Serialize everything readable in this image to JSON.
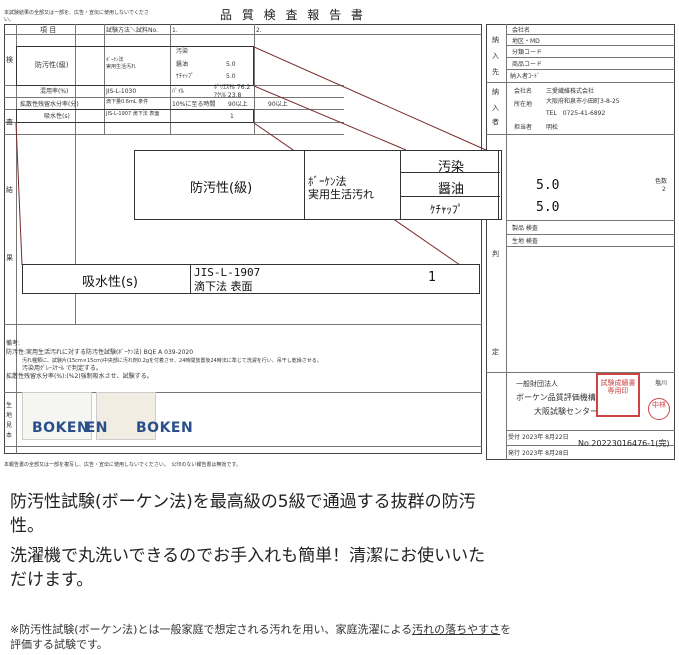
{
  "report": {
    "title": "品 質 検 査 報 告 書",
    "top_notice": "本試験結果の全部又は一部を、広告・宣伝に使用しないでください。",
    "col_item": "項 目",
    "col_method": "試験方法＼試料No.",
    "col1": "1.",
    "col2": "2.",
    "side_left": [
      "検",
      "査",
      "結",
      "果"
    ],
    "rows": [
      {
        "item": "防汚性(級)",
        "method": "ﾎﾞｰｹﾝ法\n実用生活汚れ",
        "stains": [
          "汚染",
          "醤油",
          "ｹﾁｬｯﾌﾟ"
        ],
        "values": [
          "",
          "5.0",
          "5.0"
        ]
      },
      {
        "item": "混用率(%)",
        "method": "JIS-L-1030",
        "comp1": "ﾊﾟｲﾙ",
        "comp2": "ﾎﾟﾘｴｽﾃﾙ 76.2",
        "comp3": "ｱｸﾘﾙ 23.8"
      },
      {
        "item": "拡散性残留水分率(分)",
        "method": "滴下量0.6mL 条件",
        "v1": "10%に至る時間",
        "v2": "90以上",
        "v3": "90以上"
      },
      {
        "item": "吸水性(s)",
        "method": "JIS-L-1907 滴下法 表面",
        "value": "1"
      }
    ],
    "remarks_label": "備考:",
    "remarks": [
      "防汚性:実用生活汚れに対する防汚性試験(ﾎﾞｰｹﾝ法) BQE A 039-2020",
      "汚れ種類に、試験片(15cm×15cm)中央部に汚れ剤0.2gを付着させ、24時間放置後24時法に準じて洗濯を行い、吊干し乾燥させる。",
      "汚染用ｸﾞﾚｰｽｹｰﾙ で判定する。",
      "拡散性残留水分率(%):(%2)強制吸水させ、試験する。"
    ],
    "sample_label": [
      "生",
      "地",
      "見",
      "本"
    ],
    "footer_note": "本報告書の全部又は一部を複写し、広告・宣伝に使用しないでください。　公印のない報告書は無効です。",
    "watermark_logo": "BOKEN",
    "right": {
      "side1": [
        "納",
        "入",
        "先"
      ],
      "side2": [
        "納",
        "入",
        "者"
      ],
      "side3": [
        "判",
        "定"
      ],
      "company": "会社名",
      "region": "地区・MD",
      "cat_code": "分類コード",
      "item_code": "商品コード",
      "sup_code": "納入者ｺｰﾄﾞ",
      "company2_label": "会社名",
      "company2": "三愛繊維株式会社",
      "address_label": "所在地",
      "address": "大阪府和泉市小田町3-8-25",
      "tel": "TEL　0725-41-6892",
      "person_label": "担当者",
      "person": "明松",
      "color_label": "色数",
      "color_value": "2",
      "product_check": "製品 検査",
      "fabric_check": "生地 検査",
      "org_type": "一般財団法人",
      "org_name": "ボーケン品質評価機構",
      "org_branch": "大阪試験センター",
      "stamp_text": "試験成績書専用印",
      "seal_text": "中林",
      "issuer": "塩川",
      "received_label": "受付",
      "received_date": "2023年 8月22日",
      "issued_label": "発行",
      "issued_date": "2023年 8月28日",
      "report_no": "No.20223016476-1(完)"
    }
  },
  "zoom": {
    "stain_header": "汚染",
    "item": "防汚性(級)",
    "method_line1": "ﾎﾞｰｹﾝ法",
    "method_line2": "実用生活汚れ",
    "soy_label": "醤油",
    "soy_value": "5.0",
    "ketchup_label": "ｹﾁｬｯﾌﾟ",
    "ketchup_value": "5.0",
    "absorb_item": "吸水性(s)",
    "absorb_method1": "JIS-L-1907",
    "absorb_method2": "滴下法 表面",
    "absorb_value": "1"
  },
  "caption": {
    "line1": "防汚性試験(ボーケン法)を最高級の5級で通過する抜群の防汚",
    "line2": "性。",
    "line3": "洗濯機で丸洗いできるのでお手入れも簡単！清潔にお使いいた",
    "line4": "だけます。",
    "note_pre": "※防汚性試験(ボーケン法)とは一般家庭で想定される汚れを用い、家庭洗濯による",
    "note_u": "汚れの落ちやすさ",
    "note_post": "を",
    "note_line2": "評価する試験です。"
  }
}
